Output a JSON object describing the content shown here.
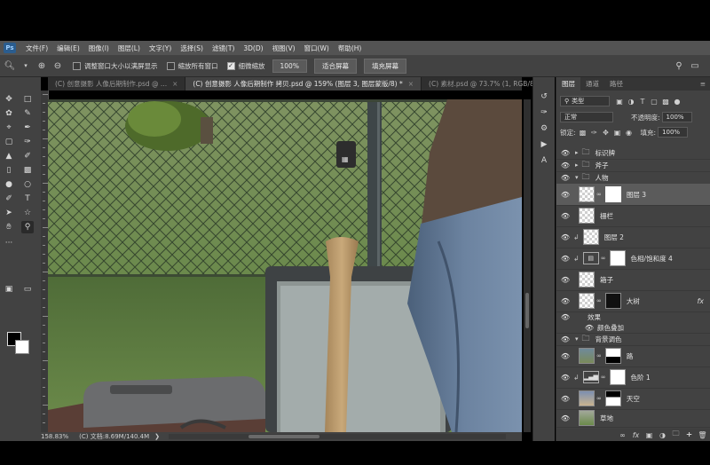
{
  "menubar": {
    "logo": "Ps",
    "items": [
      "文件(F)",
      "编辑(E)",
      "图像(I)",
      "图层(L)",
      "文字(Y)",
      "选择(S)",
      "滤镜(T)",
      "3D(D)",
      "视图(V)",
      "窗口(W)",
      "帮助(H)"
    ]
  },
  "options": {
    "resize_windows_label": "调整窗口大小以满屏显示",
    "zoom_all_label": "缩放所有窗口",
    "scrubby_zoom_label": "细微缩放",
    "zoom_100_label": "100%",
    "fit_screen_label": "适合屏幕",
    "fill_screen_label": "填充屏幕"
  },
  "tabs": [
    {
      "label": "(C) 创意摄影 人像后期制作.psd @ ...",
      "active": false
    },
    {
      "label": "(C) 创意摄影 人像后期制作 拷贝.psd @ 159% (图层 3, 图层蒙版/8) *",
      "active": true
    },
    {
      "label": "(C) 素材.psd @ 73.7% (1, RGB/8...",
      "active": false
    }
  ],
  "status": {
    "zoom": "158.83%",
    "doc": "(C) 文档:8.69M/140.4M"
  },
  "layers_panel": {
    "tabs": [
      "图层",
      "通道",
      "路径"
    ],
    "filter_kind": "类型",
    "blend_mode": "正常",
    "opacity_label": "不透明度:",
    "opacity_value": "100%",
    "lock_label": "锁定:",
    "fill_label": "填充:",
    "fill_value": "100%",
    "layers": [
      {
        "name": "标识牌",
        "type": "group"
      },
      {
        "name": "斧子",
        "type": "group"
      },
      {
        "name": "人物",
        "type": "group-open"
      },
      {
        "name": "图层 3",
        "type": "masked",
        "selected": true
      },
      {
        "name": "栅栏",
        "type": "pixel"
      },
      {
        "name": "图层 2",
        "type": "clipped"
      },
      {
        "name": "色相/饱和度 4",
        "type": "adjustment"
      },
      {
        "name": "箱子",
        "type": "pixel"
      },
      {
        "name": "大树",
        "type": "masked-fx",
        "fx": "fx"
      },
      {
        "name": "效果",
        "type": "effect-header"
      },
      {
        "name": "颜色叠加",
        "type": "effect"
      },
      {
        "name": "背景调色",
        "type": "group"
      },
      {
        "name": "路",
        "type": "masked-photo"
      },
      {
        "name": "色阶 1",
        "type": "levels"
      },
      {
        "name": "天空",
        "type": "masked-sky"
      },
      {
        "name": "草地",
        "type": "grass"
      }
    ]
  },
  "colors": {
    "foreground": "#000000",
    "background": "#ffffff",
    "panel_bg": "#424242",
    "selected_layer": "#5b5b5b"
  }
}
